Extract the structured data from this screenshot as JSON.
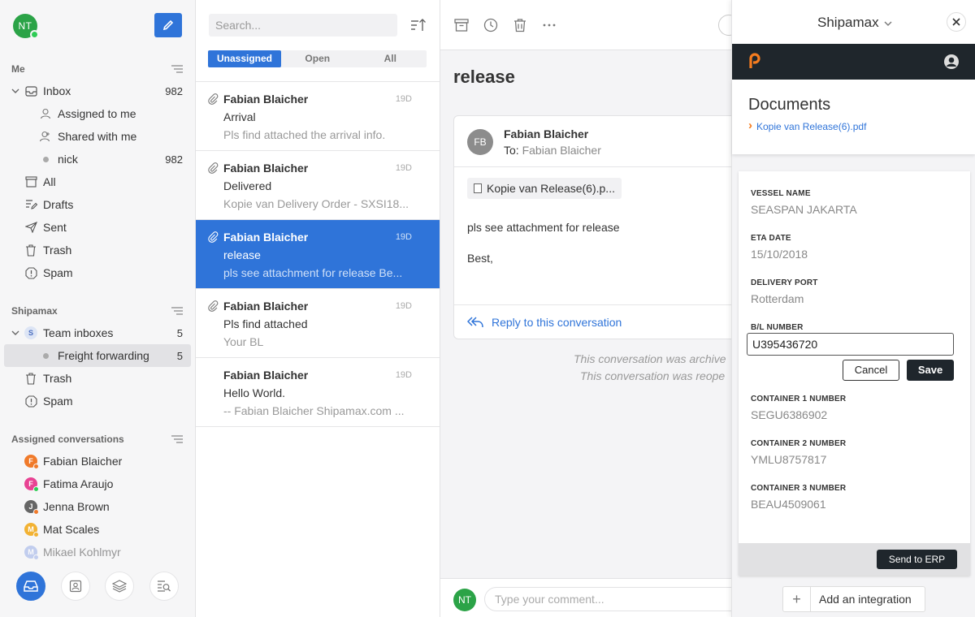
{
  "sidebar": {
    "user_initials": "NT",
    "sections": {
      "me": "Me",
      "shipamax": "Shipamax",
      "assigned": "Assigned conversations"
    },
    "me_items": [
      {
        "label": "Inbox",
        "count": "982"
      },
      {
        "label": "Assigned to me",
        "count": ""
      },
      {
        "label": "Shared with me",
        "count": ""
      },
      {
        "label": "nick",
        "count": "982"
      },
      {
        "label": "All",
        "count": ""
      },
      {
        "label": "Drafts",
        "count": ""
      },
      {
        "label": "Sent",
        "count": ""
      },
      {
        "label": "Trash",
        "count": ""
      },
      {
        "label": "Spam",
        "count": ""
      }
    ],
    "shipamax_items": [
      {
        "label": "Team inboxes",
        "count": "5",
        "badge": "S"
      },
      {
        "label": "Freight forwarding",
        "count": "5"
      },
      {
        "label": "Trash",
        "count": ""
      },
      {
        "label": "Spam",
        "count": ""
      }
    ],
    "assigned_people": [
      {
        "initial": "F",
        "name": "Fabian Blaicher",
        "color": "#f07a2a",
        "status": "#f07a2a"
      },
      {
        "initial": "F",
        "name": "Fatima Araujo",
        "color": "#e84393",
        "status": "#2ecc55"
      },
      {
        "initial": "J",
        "name": "Jenna Brown",
        "color": "#666666",
        "status": "#f07a2a"
      },
      {
        "initial": "M",
        "name": "Mat Scales",
        "color": "#f2b233",
        "status": "#f2b233"
      },
      {
        "initial": "M",
        "name": "Mikael Kohlmyr",
        "color": "#8ea6e6",
        "status": "#8ea6e6"
      }
    ]
  },
  "conversation_list": {
    "search_placeholder": "Search...",
    "tabs": [
      "Unassigned",
      "Open",
      "All"
    ],
    "conversations": [
      {
        "from": "Fabian Blaicher",
        "age": "19D",
        "subject": "Arrival",
        "preview": "Pls find attached the arrival info.",
        "attachment": true
      },
      {
        "from": "Fabian Blaicher",
        "age": "19D",
        "subject": "Delivered",
        "preview": "Kopie van Delivery Order - SXSI18...",
        "attachment": true
      },
      {
        "from": "Fabian Blaicher",
        "age": "19D",
        "subject": "release",
        "preview": "pls see attachment for release Be...",
        "attachment": true
      },
      {
        "from": "Fabian Blaicher",
        "age": "19D",
        "subject": "Pls find attached",
        "preview": "Your BL",
        "attachment": true
      },
      {
        "from": "Fabian Blaicher",
        "age": "19D",
        "subject": "Hello World.",
        "preview": "-- Fabian Blaicher Shipamax.com ...",
        "attachment": false
      }
    ]
  },
  "thread": {
    "title": "release",
    "message": {
      "sender_initials": "FB",
      "from": "Fabian Blaicher",
      "to_label": "To:",
      "to": "Fabian Blaicher",
      "attachment": "Kopie van Release(6).p...",
      "body_line1": "pls see attachment for release",
      "body_line2": "Best,"
    },
    "reply_label": "Reply to this conversation",
    "system_notes": [
      "This conversation was archive",
      "This conversation was reope"
    ],
    "comment_initials": "NT",
    "comment_placeholder": "Type your comment..."
  },
  "plugin": {
    "title": "Shipamax",
    "documents_title": "Documents",
    "document_link": "Kopie van Release(6).pdf",
    "fields": {
      "vessel_label": "VESSEL NAME",
      "vessel_value": "SEASPAN JAKARTA",
      "eta_label": "ETA DATE",
      "eta_value": "15/10/2018",
      "port_label": "DELIVERY PORT",
      "port_value": "Rotterdam",
      "bl_label": "B/L NUMBER",
      "bl_value": "U395436720",
      "c1_label": "CONTAINER 1 NUMBER",
      "c1_value": "SEGU6386902",
      "c2_label": "CONTAINER 2 NUMBER",
      "c2_value": "YMLU8757817",
      "c3_label": "CONTAINER 3 NUMBER",
      "c3_value": "BEAU4509061"
    },
    "cancel_label": "Cancel",
    "save_label": "Save",
    "send_label": "Send to ERP",
    "add_integration_label": "Add an integration"
  },
  "colors": {
    "accent": "#2f74d9",
    "dark": "#1f262c",
    "brand_orange": "#f57c1f",
    "online_green": "#2ba347"
  }
}
